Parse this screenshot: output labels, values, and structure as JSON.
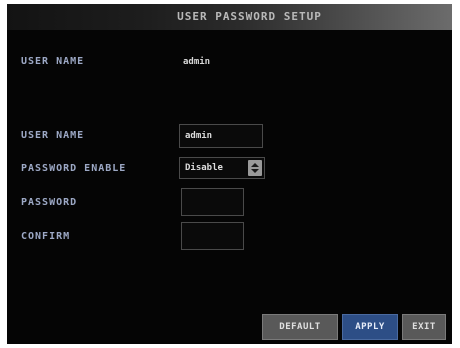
{
  "window": {
    "title": "USER PASSWORD SETUP"
  },
  "current_user": {
    "label": "USER NAME",
    "value": "admin"
  },
  "form": {
    "user_name": {
      "label": "USER NAME",
      "value": "admin"
    },
    "password_enable": {
      "label": "PASSWORD ENABLE",
      "selected": "Disable"
    },
    "password": {
      "label": "PASSWORD",
      "value": ""
    },
    "confirm": {
      "label": "CONFIRM",
      "value": ""
    }
  },
  "buttons": {
    "default_label": "DEFAULT",
    "apply_label": "APPLY",
    "exit_label": "EXIT"
  },
  "icons": {
    "select_arrow": "up-down-arrows-icon"
  },
  "colors": {
    "background": "#050505",
    "label": "#9da9c6",
    "apply_button": "#2d4e86",
    "secondary_button": "#595959"
  }
}
